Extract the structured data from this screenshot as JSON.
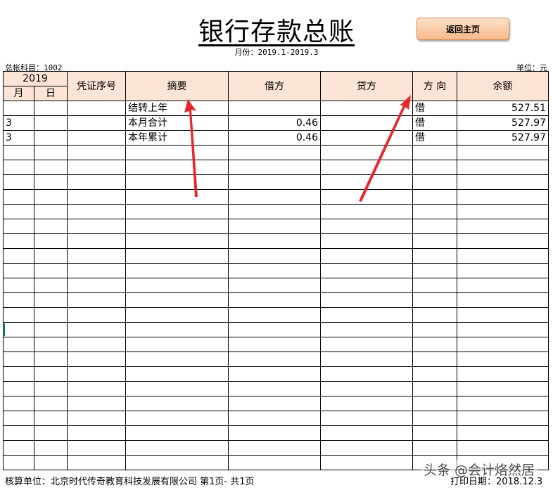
{
  "title": "银行存款总账",
  "home_button": "返回主页",
  "period": "月份：2019.1-2019.3",
  "account": "总帐科目：1002",
  "unit": "单位：元",
  "headers": {
    "year": "2019",
    "month": "月",
    "day": "日",
    "voucher": "凭证序号",
    "summary": "摘要",
    "debit": "借方",
    "credit": "贷方",
    "direction": "方 向",
    "balance": "余额"
  },
  "rows": [
    {
      "month": "",
      "day": "",
      "voucher": "",
      "summary": "结转上年",
      "debit": "",
      "credit": "",
      "direction": "借",
      "balance": "527.51"
    },
    {
      "month": "3",
      "day": "",
      "voucher": "",
      "summary": "本月合计",
      "debit": "0.46",
      "credit": "",
      "direction": "借",
      "balance": "527.97"
    },
    {
      "month": "3",
      "day": "",
      "voucher": "",
      "summary": "本年累计",
      "debit": "0.46",
      "credit": "",
      "direction": "借",
      "balance": "527.97"
    }
  ],
  "footer": "核算单位：北京时代传奇教育科技发展有限公司 第1页- 共1页",
  "print_date": "打印日期：2018.12.3",
  "watermark": "头条 @会计烙然居",
  "colors": {
    "header_bg": "#fce4d6",
    "arrow": "#e8262a",
    "button": "#f7b98a"
  }
}
